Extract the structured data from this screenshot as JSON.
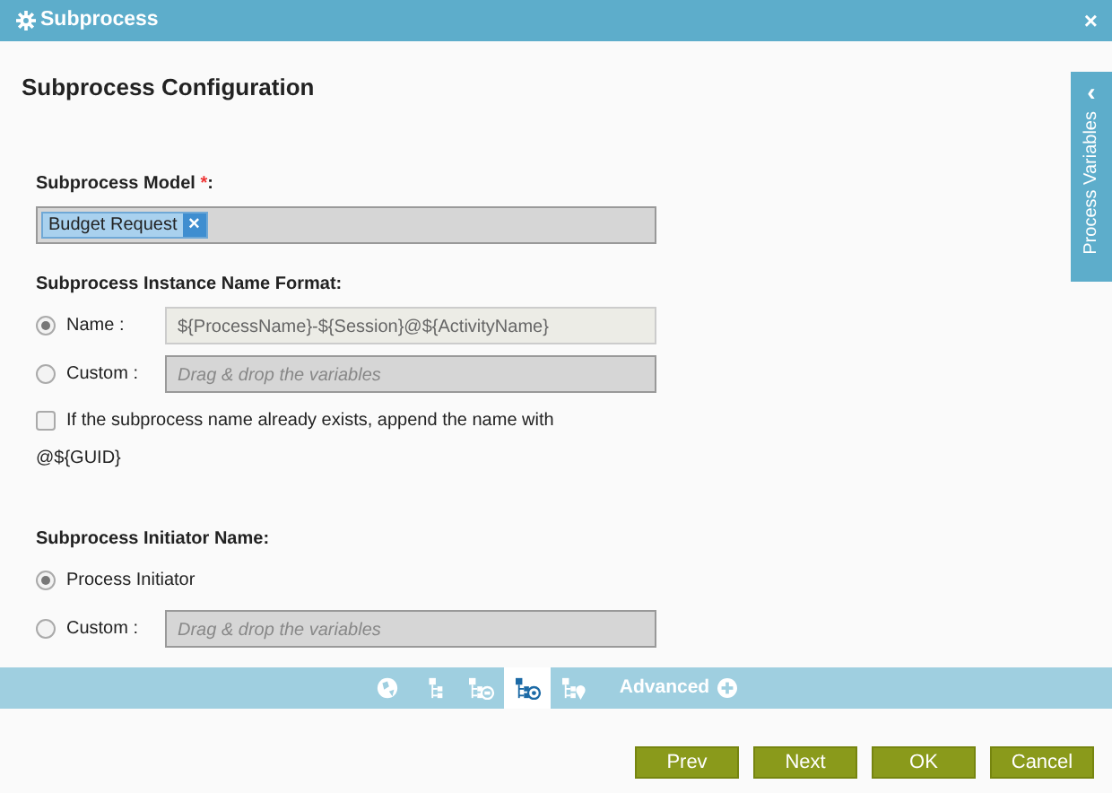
{
  "window": {
    "title": "Subprocess",
    "close": "×"
  },
  "heading": "Subprocess Configuration",
  "side_tab": {
    "label": "Process Variables",
    "arrow": "‹"
  },
  "model": {
    "label": "Subprocess Model",
    "required_mark": "*",
    "suffix": ":",
    "tags": [
      {
        "label": "Budget Request",
        "remove": "×"
      }
    ]
  },
  "name_format": {
    "label": "Subprocess Instance Name Format:",
    "options": [
      {
        "label": "Name :",
        "selected": true,
        "kind": "value",
        "value": "${ProcessName}-${Session}@${ActivityName}"
      },
      {
        "label": "Custom :",
        "selected": false,
        "kind": "drop",
        "placeholder": "Drag & drop the variables"
      }
    ],
    "append": {
      "label": "If the subprocess name already exists, append the name with",
      "label_2": "@${GUID}",
      "checked": false
    }
  },
  "initiator": {
    "label": "Subprocess Initiator Name:",
    "options": [
      {
        "label": "Process Initiator",
        "selected": true,
        "kind": "plain"
      },
      {
        "label": "Custom :",
        "selected": false,
        "kind": "drop",
        "placeholder": "Drag & drop the variables"
      }
    ]
  },
  "toolbar": {
    "items": [
      {
        "kind": "globe",
        "selected": false
      },
      {
        "kind": "tree",
        "selected": false
      },
      {
        "kind": "mail",
        "selected": false
      },
      {
        "kind": "target",
        "selected": true
      },
      {
        "kind": "pin",
        "selected": false
      }
    ],
    "advanced": "Advanced"
  },
  "buttons": [
    "Prev",
    "Next",
    "OK",
    "Cancel"
  ]
}
